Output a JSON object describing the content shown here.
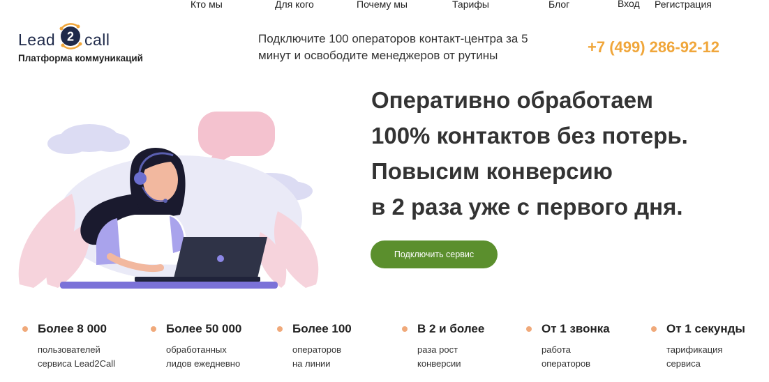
{
  "nav": {
    "items": [
      "Кто мы",
      "Для кого",
      "Почему мы",
      "Тарифы",
      "Блог"
    ],
    "login": "Вход",
    "register": "Регистрация"
  },
  "logo": {
    "part1": "Lead",
    "badge": "2",
    "part2": "call",
    "subtitle": "Платформа коммуникаций"
  },
  "header": {
    "tagline": "Подключите 100 операторов контакт-центра за 5 минут и освободите менеджеров от рутины",
    "phone": "+7 (499) 286-92-12"
  },
  "hero": {
    "lines": [
      "Оперативно обработаем",
      "100% контактов без потерь.",
      "Повысим конверсию",
      "в 2 раза уже с первого дня."
    ],
    "cta": "Подключить сервис"
  },
  "stats": [
    {
      "title": "Более 8 000",
      "line1": "пользователей",
      "line2": "сервиса Lead2Call"
    },
    {
      "title": "Более 50 000",
      "line1": "обработанных",
      "line2": "лидов ежедневно"
    },
    {
      "title": "Более 100",
      "line1": "операторов",
      "line2": "на линии"
    },
    {
      "title": "В 2 и более",
      "line1": "раза рост",
      "line2": "конверсии"
    },
    {
      "title": "От 1 звонка",
      "line1": "работа",
      "line2": "операторов"
    },
    {
      "title": "От 1 секунды",
      "line1": "тарификация",
      "line2": "сервиса"
    }
  ],
  "colors": {
    "accent": "#f0a63a",
    "cta": "#5b8f2d",
    "dot": "#f0a97a",
    "heading": "#333333"
  }
}
